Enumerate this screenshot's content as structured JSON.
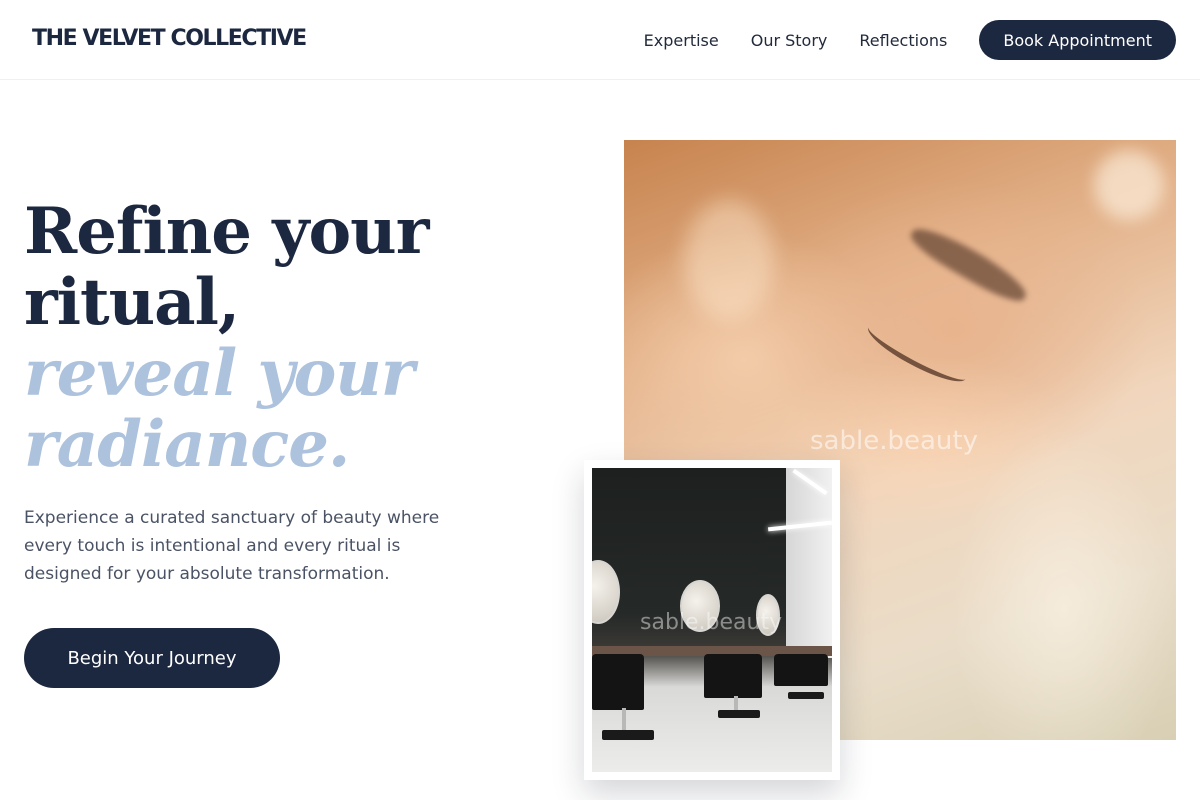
{
  "header": {
    "brand": "THE VELVET COLLECTIVE",
    "nav": [
      "Expertise",
      "Our Story",
      "Reflections"
    ],
    "book_button": "Book Appointment"
  },
  "hero": {
    "headline_lines": [
      "Refine your",
      "ritual,"
    ],
    "headline_accent_lines": [
      "reveal your",
      "radiance."
    ],
    "subtext": "Experience a curated sanctuary of beauty where every touch is intentional and every ritual is designed for your absolute transformation.",
    "cta": "Begin Your Journey"
  },
  "images": {
    "main_watermark": "sable.beauty",
    "inset_watermark": "sable.beauty"
  },
  "colors": {
    "navy": "#1c2740",
    "accent_blue": "#adc2dc",
    "body_text": "#4a5365"
  }
}
